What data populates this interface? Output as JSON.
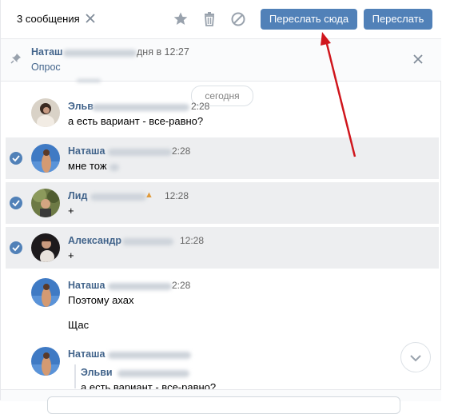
{
  "header": {
    "selected_count": "3 сообщения",
    "forward_here_label": "Переслать сюда",
    "forward_label": "Переслать"
  },
  "pinned": {
    "author": "Наташ",
    "time_text": "дня в 12:27",
    "text": "Опрос"
  },
  "date_divider": "сегодня",
  "messages": [
    {
      "author": "Эльв",
      "time": "2:28",
      "text": "а есть вариант - все-равно?",
      "selected": false
    },
    {
      "author": "Наташа",
      "time": "2:28",
      "text": "мне тож",
      "selected": true
    },
    {
      "author": "Лид",
      "time": "12:28",
      "text": "+",
      "selected": true
    },
    {
      "author": "Александр",
      "time": "12:28",
      "text": "+",
      "selected": true
    },
    {
      "author": "Наташа",
      "time": "2:28",
      "text": "Поэтому ахах",
      "text2": "Щас",
      "selected": false
    },
    {
      "author": "Наташа",
      "time": "",
      "quote_author": "Эльви",
      "quote_text": "а есть вариант - все-равно?",
      "selected": false
    }
  ],
  "colors": {
    "accent": "#5181b8",
    "link": "#42648b",
    "selected_bg": "#edeef0",
    "annotation_arrow": "#d0161d"
  },
  "icons": [
    "close-icon",
    "star-icon",
    "trash-icon",
    "block-icon",
    "pin-icon",
    "check-icon",
    "chevron-down-icon"
  ]
}
